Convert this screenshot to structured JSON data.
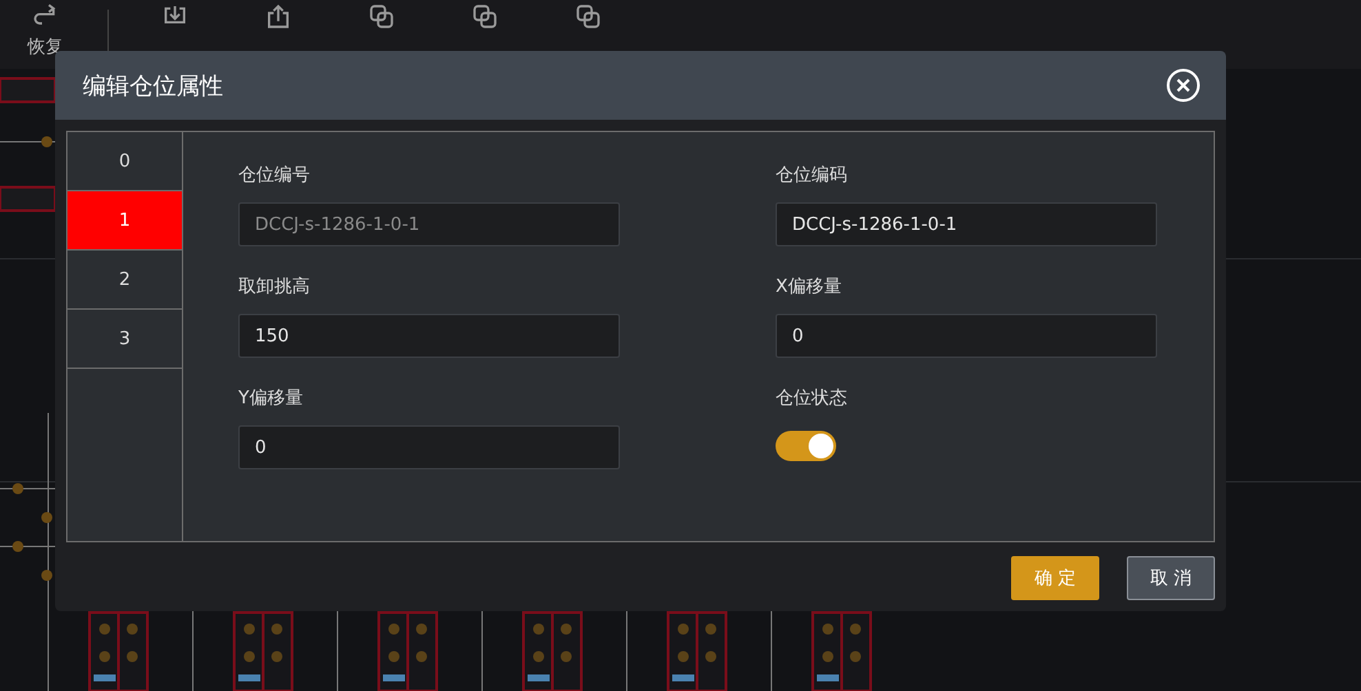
{
  "toolbar": [
    {
      "label": "恢复",
      "kind": "redo"
    },
    {
      "kind": "import"
    },
    {
      "kind": "export"
    },
    {
      "kind": "merge"
    },
    {
      "kind": "merge"
    },
    {
      "kind": "merge"
    }
  ],
  "dialog": {
    "title": "编辑仓位属性",
    "slots": [
      {
        "label": "0",
        "selected": false
      },
      {
        "label": "1",
        "selected": true
      },
      {
        "label": "2",
        "selected": false
      },
      {
        "label": "3",
        "selected": false
      }
    ],
    "fields": [
      {
        "kind": "input",
        "label": "仓位编号",
        "value": "DCCJ-s-1286-1-0-1",
        "disabled": true
      },
      {
        "kind": "input",
        "label": "仓位编码",
        "value": "DCCJ-s-1286-1-0-1",
        "disabled": false
      },
      {
        "kind": "input",
        "label": "取卸挑高",
        "value": "150",
        "disabled": false
      },
      {
        "kind": "input",
        "label": "X偏移量",
        "value": "0",
        "disabled": false
      },
      {
        "kind": "input",
        "label": "Y偏移量",
        "value": "0",
        "disabled": false
      },
      {
        "kind": "switch",
        "label": "仓位状态",
        "on": true
      }
    ],
    "buttons": [
      {
        "label": "确 定",
        "kind": "primary"
      },
      {
        "label": "取 消",
        "kind": "secondary"
      }
    ]
  }
}
